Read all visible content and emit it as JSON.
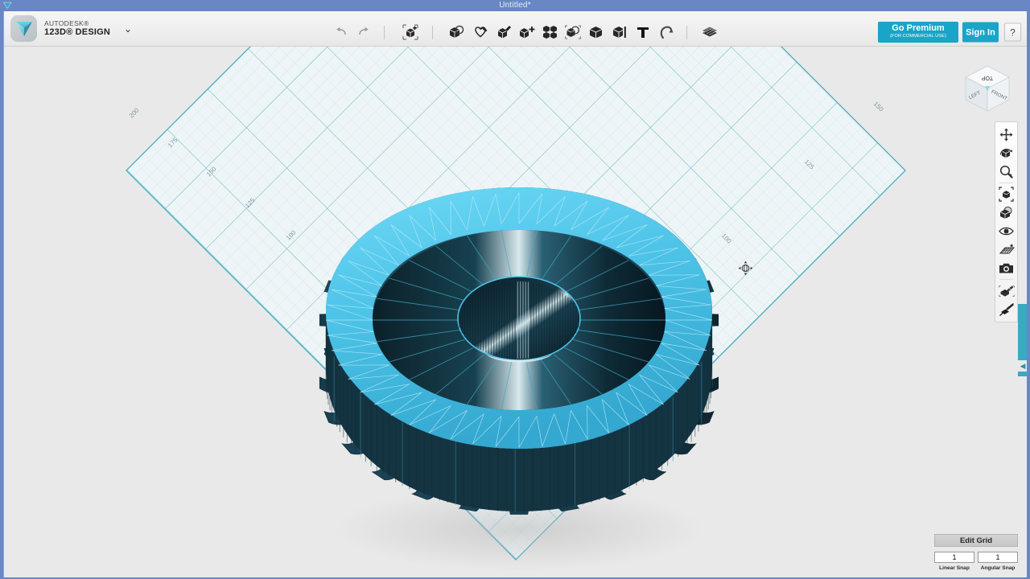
{
  "window": {
    "title": "Untitled*",
    "system_icon": "app-icon"
  },
  "brand": {
    "company": "AUTODESK®",
    "product": "123D® DESIGN",
    "chevron": "⌄",
    "logo_icon": "autodesk-logo-icon"
  },
  "toolbar": {
    "items": [
      {
        "name": "undo-button",
        "icon": "undo-arrow-icon"
      },
      {
        "name": "redo-button",
        "icon": "redo-arrow-icon"
      },
      {
        "name": "new-object-button",
        "icon": "add-object-icon"
      },
      {
        "name": "transform-button",
        "icon": "transform-icon"
      },
      {
        "name": "primitives-button",
        "icon": "primitives-heart-icon"
      },
      {
        "name": "sketch-button",
        "icon": "sketch-pencil-icon"
      },
      {
        "name": "construct-button",
        "icon": "construct-plus-icon"
      },
      {
        "name": "pattern-button",
        "icon": "pattern-grid-icon"
      },
      {
        "name": "combine-button",
        "icon": "combine-icon"
      },
      {
        "name": "modify-button",
        "icon": "modify-cube-icon"
      },
      {
        "name": "grouping-button",
        "icon": "grouping-icon"
      },
      {
        "name": "text-button",
        "icon": "text-t-icon"
      },
      {
        "name": "snap-button",
        "icon": "snap-magnet-icon"
      },
      {
        "name": "material-button",
        "icon": "material-mesh-icon"
      }
    ]
  },
  "account": {
    "premium_label": "Go Premium",
    "premium_sub": "(FOR COMMERCIAL USE)",
    "signin_label": "Sign In",
    "help_label": "?",
    "accent_color": "#19a5c7"
  },
  "viewcube": {
    "top_label": "TOP",
    "left_label": "LEFT",
    "front_label": "FRONT"
  },
  "navbar": {
    "items": [
      {
        "name": "pan-tool",
        "icon": "pan-arrows-icon"
      },
      {
        "name": "orbit-tool",
        "icon": "orbit-cube-icon"
      },
      {
        "name": "zoom-tool",
        "icon": "zoom-magnifier-icon"
      },
      {
        "name": "fit-view-tool",
        "icon": "fit-to-window-icon"
      },
      {
        "name": "hide-show-tool",
        "icon": "hide-show-shapes-icon"
      },
      {
        "name": "visibility-tool",
        "icon": "eye-icon"
      },
      {
        "name": "grid-tool",
        "icon": "grid-perspective-icon"
      },
      {
        "name": "camera-tool",
        "icon": "camera-icon"
      },
      {
        "name": "material-tool",
        "icon": "paint-bucket-icon"
      },
      {
        "name": "measure-tool",
        "icon": "measure-ruler-icon"
      }
    ]
  },
  "grid": {
    "edit_label": "Edit Grid",
    "linear_snap_value": "1",
    "angular_snap_value": "1",
    "linear_snap_label": "Linear Snap",
    "angular_snap_label": "Angular Snap",
    "line_color": "#5fb6c4",
    "fill_color": "#eaf3f5",
    "left_labels": [
      "200",
      "175",
      "150",
      "125",
      "100"
    ],
    "right_labels": [
      "150",
      "125",
      "100"
    ]
  },
  "cursor": {
    "icon": "orbit-cursor-icon"
  },
  "model": {
    "name": "gear-turbine-mesh",
    "body_color": "#1d3f4d",
    "highlight_color": "#4fc8ec",
    "shadow_color": "#d6d6d6",
    "tooth_count": 24,
    "inner_spoke_count": 26
  },
  "scrollbar": {
    "arrow_glyph": "◀"
  }
}
